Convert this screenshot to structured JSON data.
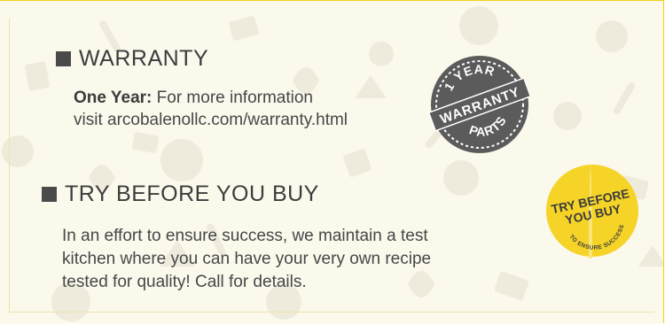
{
  "warranty": {
    "heading": "WARRANTY",
    "label": "One Year:",
    "line1": " For more information",
    "line2": "visit arcobalenollc.com/warranty.html",
    "badge": {
      "top": "1 YEAR",
      "middle": "WARRANTY",
      "bottom": "PARTS"
    }
  },
  "try_before": {
    "heading": "TRY BEFORE YOU BUY",
    "line1": "In an effort to ensure success, we maintain a test",
    "line2": "kitchen where you can have your very own recipe",
    "line3": "tested for quality! Call for details.",
    "badge": {
      "line1": "TRY BEFORE",
      "line2": "YOU BUY",
      "line3": "TO ENSURE SUCCESS"
    }
  },
  "colors": {
    "accent_yellow": "#f5d327",
    "badge_gray": "#5b5b5b",
    "text": "#474747"
  }
}
